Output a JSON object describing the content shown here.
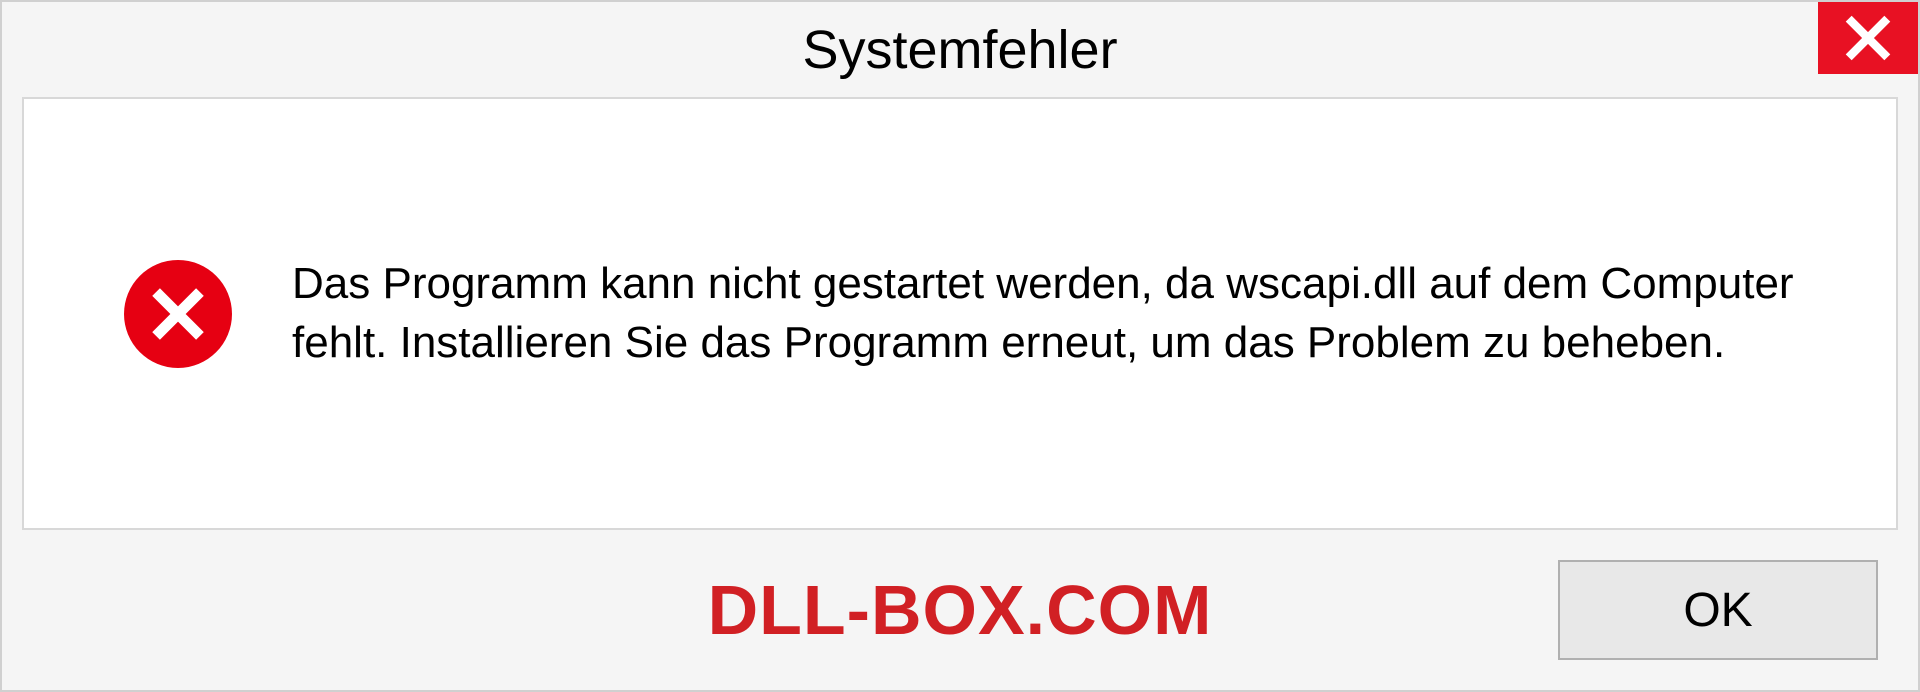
{
  "dialog": {
    "title": "Systemfehler",
    "message": "Das Programm kann nicht gestartet werden, da wscapi.dll auf dem Computer fehlt. Installieren Sie das Programm erneut, um das Problem zu beheben.",
    "ok_label": "OK"
  },
  "watermark": "DLL-BOX.COM"
}
